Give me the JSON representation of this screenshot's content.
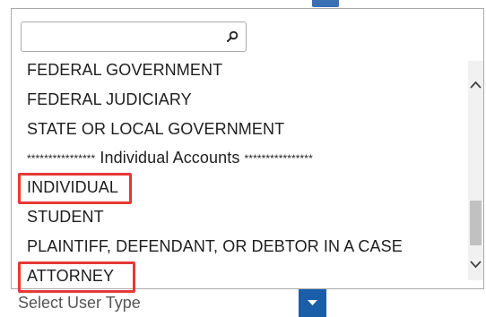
{
  "search": {
    "value": "",
    "placeholder": ""
  },
  "options": [
    {
      "label": "FEDERAL GOVERNMENT"
    },
    {
      "label": "FEDERAL JUDICIARY"
    },
    {
      "label": "STATE OR LOCAL GOVERNMENT"
    },
    {
      "label_prefix": "****************",
      "label_middle": " Individual Accounts ",
      "label_suffix": "****************"
    },
    {
      "label": "INDIVIDUAL"
    },
    {
      "label": "STUDENT"
    },
    {
      "label": "PLAINTIFF, DEFENDANT, OR DEBTOR IN A CASE"
    },
    {
      "label": "ATTORNEY"
    }
  ],
  "select": {
    "label": "Select User Type"
  },
  "colors": {
    "highlight": "#e53935",
    "accent": "#1a5ea8"
  },
  "icons": {
    "search": "search-icon",
    "scroll_up": "chevron-up-icon",
    "scroll_down": "chevron-down-icon",
    "select_caret": "caret-down-icon"
  }
}
